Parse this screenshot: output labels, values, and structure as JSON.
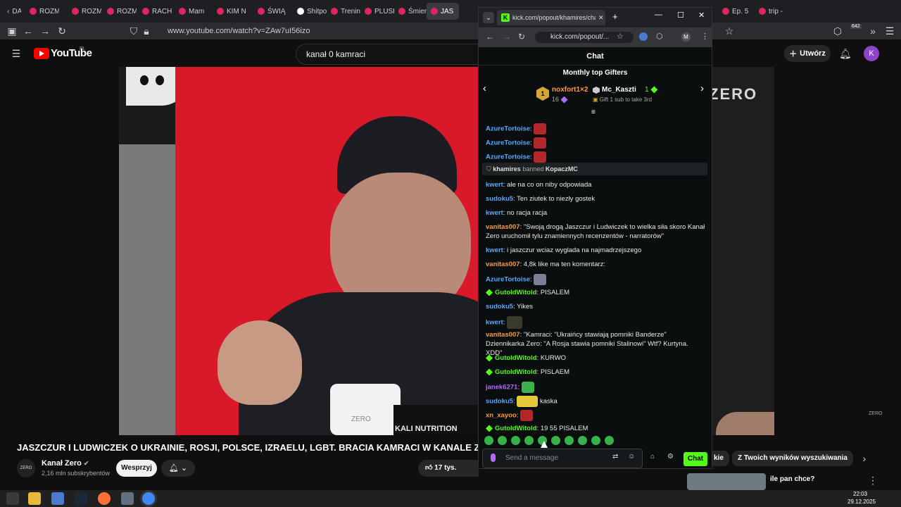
{
  "browser": {
    "tabs": [
      "DA",
      "ROZM",
      "ROZM",
      "ROZM",
      "RACH",
      "Mam",
      "KIM N",
      "ŚWIĄ",
      "Shitpo",
      "Trenin",
      "PLUSK",
      "Śmier",
      "JAS"
    ],
    "right_tabs": [
      "Ep. 5",
      "trip -"
    ],
    "url": "www.youtube.com/watch?v=ZAw7uI56izo",
    "badge_count": "642"
  },
  "youtube": {
    "logo_text": "YouTube",
    "logo_region": "PL",
    "search_value": "kanał 0 kamraci",
    "create_label": "Utwórz",
    "avatar_letter": "K",
    "video_title": "JASZCZUR I LUDWICZEK O UKRAINIE, ROSJI, POLSCE, IZRAELU, LGBT. BRACIA KAMRACI W KANALE ZERO",
    "channel_name": "Kanał Zero",
    "channel_avatar": "ZERO",
    "subscribers": "2,16 mln subskrybentów",
    "support_label": "Wesprzyj",
    "likes": "17 tys.",
    "chips": [
      "kie",
      "Z Twoich wyników wyszukiwania"
    ],
    "suggestion_title": "ile pan chce?",
    "video_brand": "ZERO",
    "mug_text": "ZERO",
    "product_text": "KALI NUTRITION"
  },
  "popout": {
    "tab_title": "kick.com/popout/khamires/cha",
    "url": "kick.com/popout/...",
    "profile_letter": "M",
    "chat_title": "Chat",
    "gifters_title": "Monthly top Gifters",
    "gifter1": {
      "rank": "1",
      "name": "noxfort1×2",
      "count": "16"
    },
    "gifter2": {
      "name": "Mc_Kaszti",
      "count": "1",
      "note": "Gift 1 sub to take 3rd"
    },
    "ban": {
      "mod": "khamires",
      "action": "banned",
      "target": "KopaczMC"
    },
    "messages": [
      {
        "user": "AzureTortoise",
        "color": "#5aa7ff",
        "text": "",
        "emote": "red"
      },
      {
        "user": "AzureTortoise",
        "color": "#5aa7ff",
        "text": "",
        "emote": "red"
      },
      {
        "user": "AzureTortoise",
        "color": "#5aa7ff",
        "text": "",
        "emote": "red"
      },
      {
        "user": "kwert",
        "color": "#5aa7ff",
        "text": "ale na co on niby odpowiada"
      },
      {
        "user": "sudoku5",
        "color": "#5aa7ff",
        "text": "Ten ziutek to niezły gostek"
      },
      {
        "user": "kwert",
        "color": "#5aa7ff",
        "text": "no racja racja"
      },
      {
        "user": "vanitas007",
        "color": "#ff9b3d",
        "text": "\"Swoją drogą Jaszczur i Ludwiczek to wielka siła skoro Kanał Zero uruchomił tylu znamiennych recenzentów - narratorów\""
      },
      {
        "user": "kwert",
        "color": "#5aa7ff",
        "text": "i jaszczur wciaz wyglada na najmadrzejszego"
      },
      {
        "user": "vanitas007",
        "color": "#ff9b3d",
        "text": "4,8k like ma ten komentarz:"
      },
      {
        "user": "AzureTortoise",
        "color": "#5aa7ff",
        "text": "",
        "emote": "face"
      },
      {
        "user": "GutoldWitold",
        "color": "#53fc18",
        "text": "PISALEM",
        "badge": true
      },
      {
        "user": "sudoku5",
        "color": "#5aa7ff",
        "text": "Yikes"
      },
      {
        "user": "kwert",
        "color": "#5aa7ff",
        "text": "",
        "emote": "dark"
      },
      {
        "user": "vanitas007",
        "color": "#ff9b3d",
        "text": "\"Kamraci: \"Ukraińcy stawiają pomniki Banderze\" Dziennikarka Zero: \"A Rosja stawia pomniki Stalinowi\" Wtf? Kurtyna. XDD\""
      },
      {
        "user": "GutoldWitold",
        "color": "#53fc18",
        "text": "KURWO",
        "badge": true
      },
      {
        "user": "GutoldWitold",
        "color": "#53fc18",
        "text": "PISLAEM",
        "badge": true
      },
      {
        "user": "janek6271",
        "color": "#b36bff",
        "text": "",
        "emote": "green"
      },
      {
        "user": "sudoku5",
        "color": "#5aa7ff",
        "text": "kaska",
        "emote": "yellow"
      },
      {
        "user": "xn_xayoo",
        "color": "#ff9b3d",
        "text": "",
        "emote": "red"
      },
      {
        "user": "GutoldWitold",
        "color": "#53fc18",
        "text": "19 55 PISALEM",
        "badge": true
      }
    ],
    "input_placeholder": "Send a message",
    "send_label": "Chat"
  },
  "taskbar": {
    "time": "22:03",
    "date": "29.12.2025"
  }
}
